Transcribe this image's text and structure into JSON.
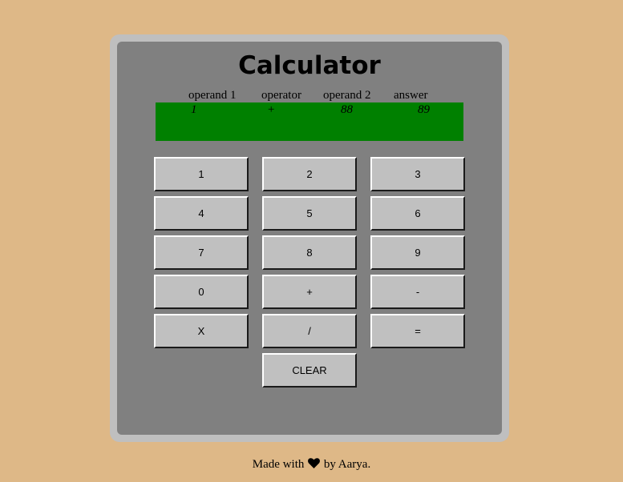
{
  "app": {
    "title": "Calculator"
  },
  "columns": {
    "operand1": "operand 1",
    "operator": "operator",
    "operand2": "operand 2",
    "answer": "answer"
  },
  "display": {
    "operand1": "1",
    "operator": "+",
    "operand2": "88",
    "answer": "89",
    "background": "#008000"
  },
  "keys": {
    "one": "1",
    "two": "2",
    "three": "3",
    "four": "4",
    "five": "5",
    "six": "6",
    "seven": "7",
    "eight": "8",
    "nine": "9",
    "zero": "0",
    "plus": "+",
    "minus": "-",
    "multiply": "X",
    "divide": "/",
    "equals": "=",
    "clear": "CLEAR"
  },
  "footer": {
    "prefix": "Made with",
    "icon": "heart-icon",
    "suffix": "by Aarya."
  },
  "colors": {
    "page_background": "#deb887",
    "frame": "#bfbfbf",
    "panel": "#808080",
    "key_face": "#c0c0c0"
  }
}
